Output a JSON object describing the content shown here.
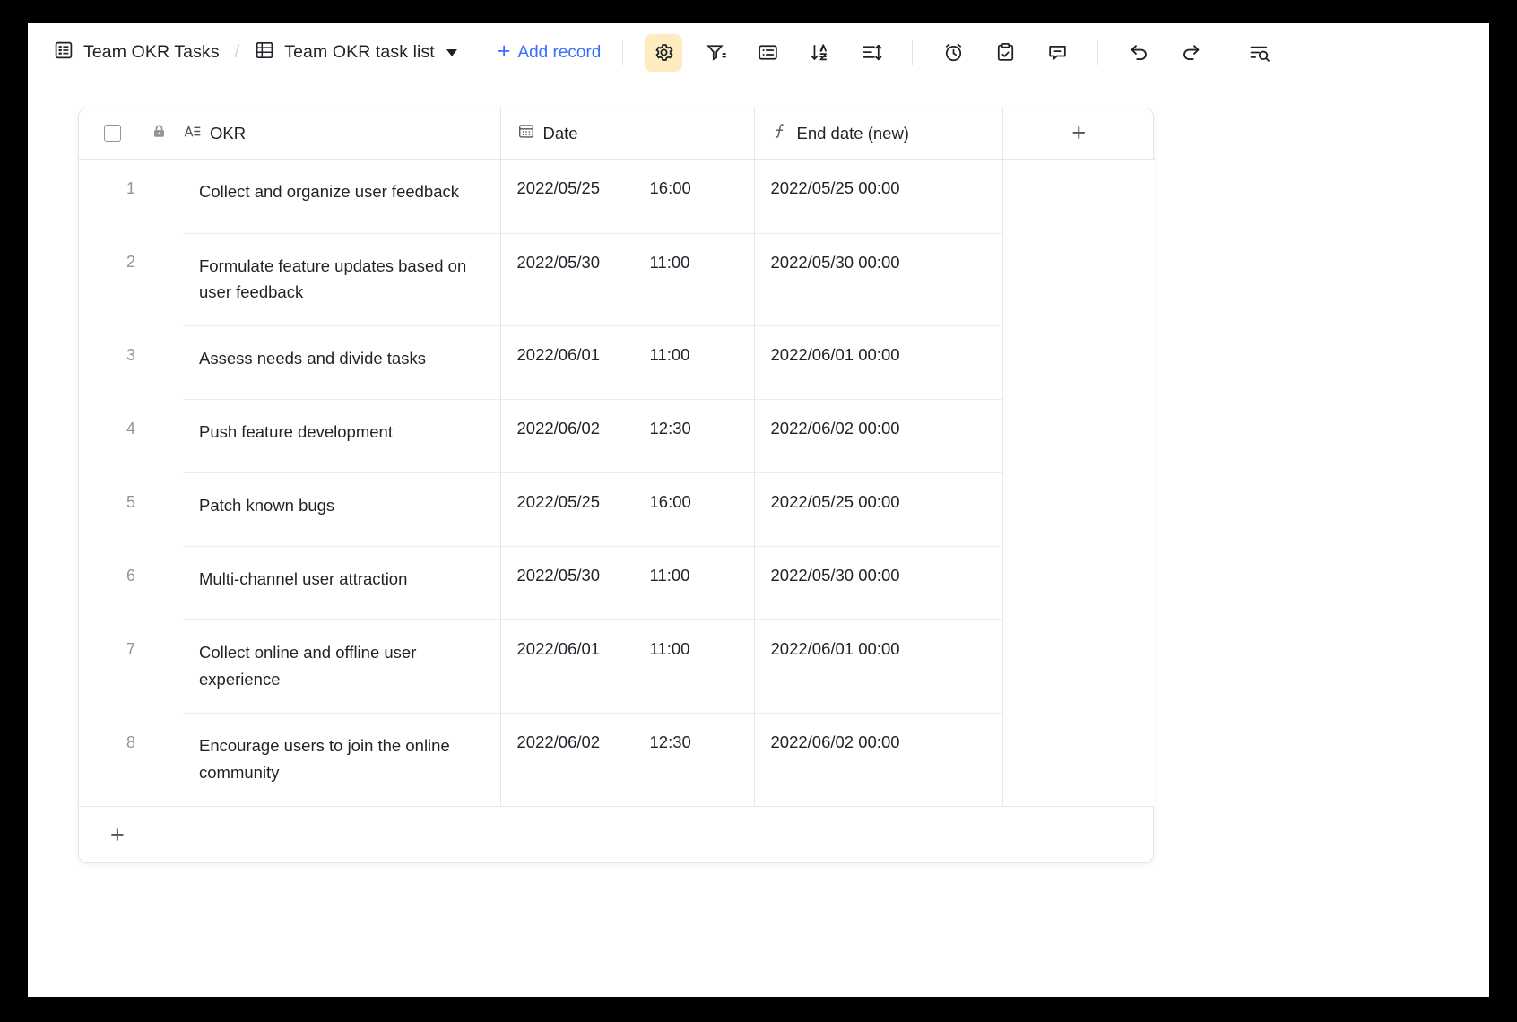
{
  "toolbar": {
    "breadcrumb": {
      "base_label": "Team OKR Tasks",
      "separator": "/",
      "view_label": "Team OKR task list"
    },
    "add_record_label": "Add record",
    "add_record_plus": "+",
    "icons": [
      {
        "name": "settings-gear-icon",
        "active": true
      },
      {
        "name": "filter-icon",
        "active": false
      },
      {
        "name": "group-list-icon",
        "active": false
      },
      {
        "name": "sort-az-icon",
        "active": false
      },
      {
        "name": "row-height-icon",
        "active": false
      },
      {
        "name": "alarm-clock-icon",
        "active": false
      },
      {
        "name": "clipboard-check-icon",
        "active": false
      },
      {
        "name": "comment-icon",
        "active": false
      },
      {
        "name": "undo-icon",
        "active": false
      },
      {
        "name": "redo-icon",
        "active": false
      },
      {
        "name": "search-rows-icon",
        "active": false
      }
    ],
    "accent_color": "#3370ff",
    "active_bg_color": "#feecc0"
  },
  "table": {
    "select_all_checkbox": "",
    "columns": [
      {
        "key": "okr",
        "label": "OKR",
        "icon": "text-field-icon",
        "locked": true
      },
      {
        "key": "date",
        "label": "Date",
        "icon": "calendar-icon",
        "locked": false
      },
      {
        "key": "end",
        "label": "End date (new)",
        "icon": "formula-field-icon",
        "locked": false
      }
    ],
    "add_column_label": "+",
    "add_row_label": "+",
    "rows": [
      {
        "index": "1",
        "okr": "Collect and organize user feedback",
        "date": "2022/05/25",
        "time": "16:00",
        "end": "2022/05/25 00:00"
      },
      {
        "index": "2",
        "okr": "Formulate feature updates based on user feedback",
        "date": "2022/05/30",
        "time": "11:00",
        "end": "2022/05/30 00:00"
      },
      {
        "index": "3",
        "okr": "Assess needs and divide tasks",
        "date": "2022/06/01",
        "time": "11:00",
        "end": "2022/06/01 00:00"
      },
      {
        "index": "4",
        "okr": "Push feature development",
        "date": "2022/06/02",
        "time": "12:30",
        "end": "2022/06/02 00:00"
      },
      {
        "index": "5",
        "okr": "Patch known bugs",
        "date": "2022/05/25",
        "time": "16:00",
        "end": "2022/05/25 00:00"
      },
      {
        "index": "6",
        "okr": "Multi-channel user attraction",
        "date": "2022/05/30",
        "time": "11:00",
        "end": "2022/05/30 00:00"
      },
      {
        "index": "7",
        "okr": "Collect online and offline user experience",
        "date": "2022/06/01",
        "time": "11:00",
        "end": "2022/06/01 00:00"
      },
      {
        "index": "8",
        "okr": "Encourage users to join the online community",
        "date": "2022/06/02",
        "time": "12:30",
        "end": "2022/06/02 00:00"
      }
    ]
  }
}
